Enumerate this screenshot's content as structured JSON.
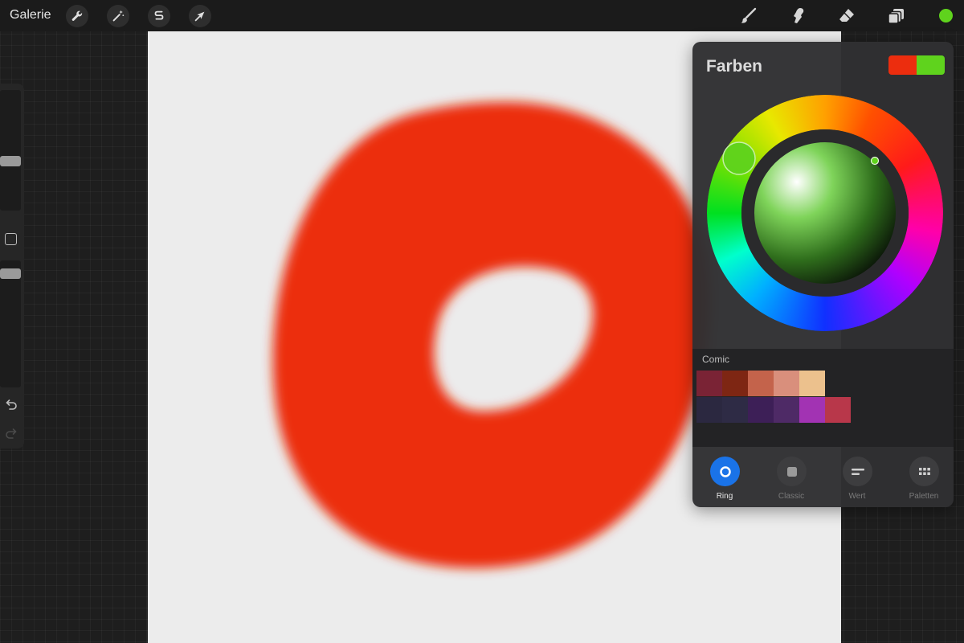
{
  "toolbar": {
    "gallery_label": "Galerie",
    "left_tools": [
      "wrench-icon",
      "magic-wand-icon",
      "selection-icon",
      "transform-icon"
    ],
    "right_tools": [
      "brush-icon",
      "smudge-icon",
      "eraser-icon",
      "layers-icon"
    ],
    "current_color": "#5fd31d"
  },
  "canvas": {
    "background": "#ececec",
    "stroke_color": "#ec2d0e"
  },
  "sidebar": {
    "icons": [
      "undo-icon",
      "redo-icon"
    ]
  },
  "color_panel": {
    "title": "Farben",
    "primary_color": "#ec2d0e",
    "secondary_color": "#5fd31d",
    "palette": {
      "name": "Comic",
      "rows": [
        [
          "#7a2335",
          "#7e2613",
          "#c4634b",
          "#d98f7c",
          "#ecc18d"
        ],
        [
          "#2b2840",
          "#2e2b45",
          "#3d1f57",
          "#4e2a66",
          "#a233b3",
          "#b8374a"
        ]
      ]
    },
    "tabs": [
      {
        "label": "Ring",
        "icon": "ring-icon",
        "active": true
      },
      {
        "label": "Classic",
        "icon": "square-icon",
        "active": false
      },
      {
        "label": "Wert",
        "icon": "value-bars-icon",
        "active": false
      },
      {
        "label": "Paletten",
        "icon": "grid-icon",
        "active": false
      }
    ]
  }
}
